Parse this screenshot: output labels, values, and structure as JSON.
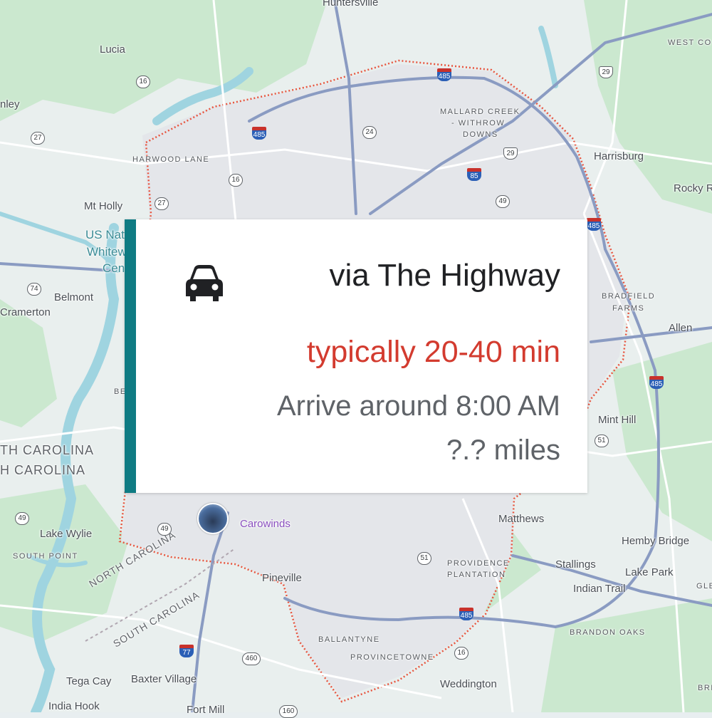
{
  "card": {
    "icon": "car-icon",
    "route_title": "via The Highway",
    "duration": "typically 20-40 min",
    "arrive": "Arrive around 8:00 AM",
    "distance": "?.? miles",
    "colors": {
      "accent": "#0f7b83",
      "duration": "#d33b2f",
      "title": "#202124",
      "secondary": "#5f6368"
    }
  },
  "map": {
    "places": {
      "huntersville": "Huntersville",
      "lucia": "Lucia",
      "stanley": "nley",
      "mt_holly": "Mt Holly",
      "belmont": "Belmont",
      "cramerton": "Cramerton",
      "lake_wylie": "Lake Wylie",
      "harrisburg": "Harrisburg",
      "rocky_river": "Rocky R",
      "allen": "Allen",
      "mint_hill": "Mint Hill",
      "matthews": "Matthews",
      "hemby_bridge": "Hemby Bridge",
      "stallings": "Stallings",
      "lake_park": "Lake Park",
      "indian_trail": "Indian Trail",
      "pineville": "Pineville",
      "weddington": "Weddington",
      "tega_cay": "Tega Cay",
      "baxter_village": "Baxter Village",
      "india_hook": "India Hook",
      "fort_mill": "Fort Mill",
      "west_co": "WEST CO",
      "gle": "GLE",
      "bri": "BRI",
      "be": "BE"
    },
    "neighborhoods": {
      "harwood_lane": "HARWOOD LANE",
      "mallard_creek_1": "MALLARD CREEK",
      "mallard_creek_2": "- WITHROW",
      "mallard_creek_3": "DOWNS",
      "bradfield_1": "BRADFIELD",
      "bradfield_2": "FARMS",
      "south_point": "SOUTH POINT",
      "providence_1": "PROVIDENCE",
      "providence_2": "PLANTATION",
      "brandon_oaks": "BRANDON OAKS",
      "ballantyne": "BALLANTYNE",
      "provincetowne": "PROVINCETOWNE"
    },
    "states": {
      "nc_left": "TH CAROLINA",
      "sc_left": "H CAROLINA",
      "nc_border": "NORTH CAROLINA",
      "sc_border": "SOUTH CAROLINA"
    },
    "water": {
      "us_nat_1": "US Nat",
      "us_nat_2": "Whitew",
      "us_nat_3": "Cen"
    },
    "poi": {
      "carowinds": "Carowinds"
    },
    "shields": {
      "i485_n": "485",
      "i485_nw": "485",
      "i485_e": "485",
      "i485_se": "485",
      "i485_s": "485",
      "i85": "85",
      "i77": "77",
      "us29_ne": "29",
      "us29": "29",
      "r16_nw": "16",
      "r16_mid": "16",
      "r16_s": "16",
      "r27_w": "27",
      "r27_mid": "27",
      "r24": "24",
      "r49_ne": "49",
      "r49_sw": "49",
      "r49_mid": "49",
      "r51_e": "51",
      "r51_s": "51",
      "r74": "74",
      "r160": "160",
      "r460": "460"
    }
  }
}
